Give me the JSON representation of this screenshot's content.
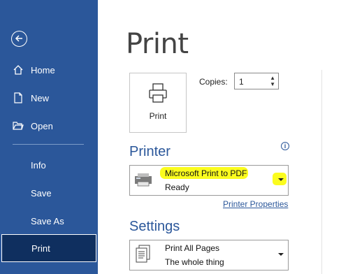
{
  "sidebar": {
    "items": [
      {
        "label": "Home"
      },
      {
        "label": "New"
      },
      {
        "label": "Open"
      },
      {
        "label": "Info"
      },
      {
        "label": "Save"
      },
      {
        "label": "Save As"
      },
      {
        "label": "Print"
      }
    ],
    "active": "Print",
    "bg_color": "#2b579a",
    "active_color": "#0f2f5f"
  },
  "main": {
    "title": "Print",
    "print_button_label": "Print",
    "copies_label": "Copies:",
    "copies_value": "1",
    "printer_heading": "Printer",
    "printer_name": "Microsoft Print to PDF",
    "printer_status": "Ready",
    "printer_properties_link": "Printer Properties",
    "settings_heading": "Settings",
    "settings_option": "Print All Pages",
    "settings_option_desc": "The whole thing",
    "accent_color": "#2b579a",
    "highlight_color": "#fbfc1e"
  },
  "icons": [
    "back-arrow-icon",
    "home-icon",
    "new-document-icon",
    "open-folder-icon",
    "printer-icon",
    "info-icon",
    "chevron-down-icon",
    "pages-icon"
  ]
}
